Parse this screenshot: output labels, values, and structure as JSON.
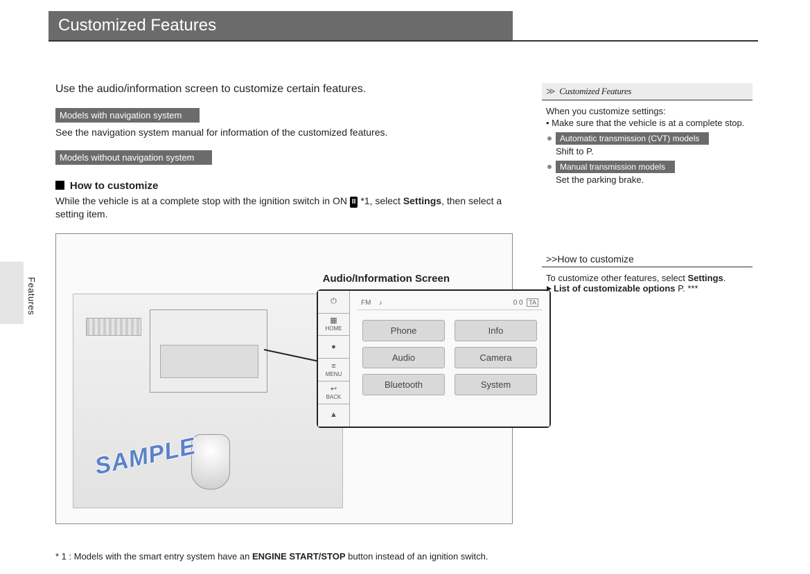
{
  "title": "Customized Features",
  "side_tab": "Features",
  "main": {
    "intro": "Use the audio/information screen to customize certain features.",
    "model_nav_chip": "Models with navigation system",
    "model_nav_text": "See the navigation system manual for information of the customized features.",
    "model_nonav_chip": "Models without navigation system",
    "heading": "How to customize",
    "para_part1": "While the vehicle is at a complete stop with the ignition switch in ON ",
    "ignition_symbol": "II",
    "para_part2": " *1, select ",
    "para_bold": "Settings",
    "para_part3": ", then select a setting item.",
    "audio_label": "Audio/Information Screen",
    "sample_stamp": "SAMPLE",
    "footnote_prefix": "* 1 :  Models with the smart entry system have an ",
    "footnote_bold": "ENGINE START/STOP",
    "footnote_suffix": " button instead of an ignition switch."
  },
  "screen": {
    "status_left": "FM",
    "status_icon": "♪",
    "status_right": "0 0",
    "ta_label": "TA",
    "buttons": {
      "home": "HOME",
      "nav": "●",
      "menu": "MENU",
      "back": "BACK",
      "power": "⏻",
      "vol": "▲"
    },
    "options": [
      "Phone",
      "Info",
      "Audio",
      "Camera",
      "Bluetooth",
      "System"
    ]
  },
  "side": {
    "breadcrumb_arrows": "≫",
    "breadcrumb_title": "Customized Features",
    "when_lead": "When you customize settings:",
    "bullet1": "• Make sure that the vehicle is at a complete stop.",
    "auto_chip": "Automatic transmission (CVT) models",
    "auto_text": "Shift to P.",
    "manual_chip": "Manual transmission models",
    "manual_text": "Set the parking brake.",
    "sec2_arrows": ">>",
    "sec2_title": "How to customize",
    "sec2_text_a": "To customize other features, select ",
    "sec2_text_bold": "Settings",
    "sec2_text_b": ".",
    "sec2_line2_prefix": " ",
    "sec2_line2_bold": "List of customizable options",
    "sec2_line2_suffix": " P. ***"
  }
}
